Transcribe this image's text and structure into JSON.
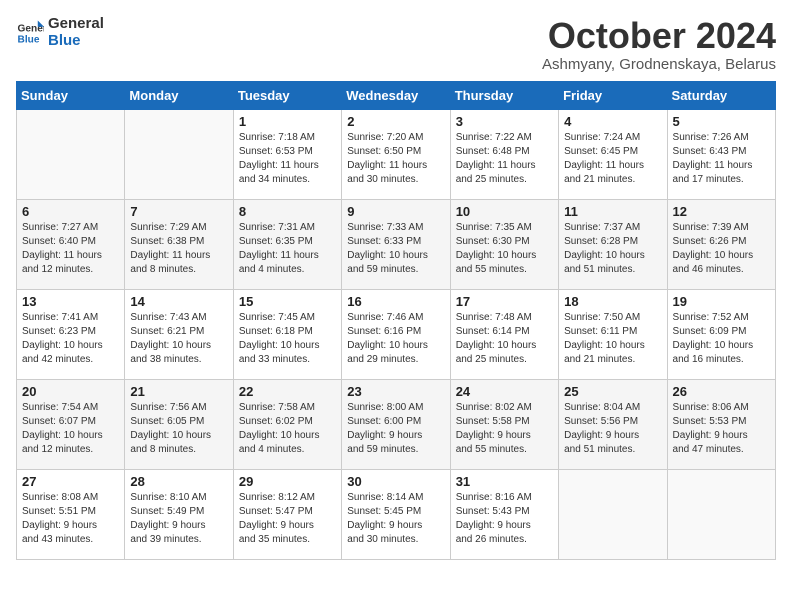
{
  "logo": {
    "line1": "General",
    "line2": "Blue"
  },
  "title": "October 2024",
  "subtitle": "Ashmyany, Grodnenskaya, Belarus",
  "weekdays": [
    "Sunday",
    "Monday",
    "Tuesday",
    "Wednesday",
    "Thursday",
    "Friday",
    "Saturday"
  ],
  "weeks": [
    [
      {
        "day": "",
        "info": ""
      },
      {
        "day": "",
        "info": ""
      },
      {
        "day": "1",
        "info": "Sunrise: 7:18 AM\nSunset: 6:53 PM\nDaylight: 11 hours\nand 34 minutes."
      },
      {
        "day": "2",
        "info": "Sunrise: 7:20 AM\nSunset: 6:50 PM\nDaylight: 11 hours\nand 30 minutes."
      },
      {
        "day": "3",
        "info": "Sunrise: 7:22 AM\nSunset: 6:48 PM\nDaylight: 11 hours\nand 25 minutes."
      },
      {
        "day": "4",
        "info": "Sunrise: 7:24 AM\nSunset: 6:45 PM\nDaylight: 11 hours\nand 21 minutes."
      },
      {
        "day": "5",
        "info": "Sunrise: 7:26 AM\nSunset: 6:43 PM\nDaylight: 11 hours\nand 17 minutes."
      }
    ],
    [
      {
        "day": "6",
        "info": "Sunrise: 7:27 AM\nSunset: 6:40 PM\nDaylight: 11 hours\nand 12 minutes."
      },
      {
        "day": "7",
        "info": "Sunrise: 7:29 AM\nSunset: 6:38 PM\nDaylight: 11 hours\nand 8 minutes."
      },
      {
        "day": "8",
        "info": "Sunrise: 7:31 AM\nSunset: 6:35 PM\nDaylight: 11 hours\nand 4 minutes."
      },
      {
        "day": "9",
        "info": "Sunrise: 7:33 AM\nSunset: 6:33 PM\nDaylight: 10 hours\nand 59 minutes."
      },
      {
        "day": "10",
        "info": "Sunrise: 7:35 AM\nSunset: 6:30 PM\nDaylight: 10 hours\nand 55 minutes."
      },
      {
        "day": "11",
        "info": "Sunrise: 7:37 AM\nSunset: 6:28 PM\nDaylight: 10 hours\nand 51 minutes."
      },
      {
        "day": "12",
        "info": "Sunrise: 7:39 AM\nSunset: 6:26 PM\nDaylight: 10 hours\nand 46 minutes."
      }
    ],
    [
      {
        "day": "13",
        "info": "Sunrise: 7:41 AM\nSunset: 6:23 PM\nDaylight: 10 hours\nand 42 minutes."
      },
      {
        "day": "14",
        "info": "Sunrise: 7:43 AM\nSunset: 6:21 PM\nDaylight: 10 hours\nand 38 minutes."
      },
      {
        "day": "15",
        "info": "Sunrise: 7:45 AM\nSunset: 6:18 PM\nDaylight: 10 hours\nand 33 minutes."
      },
      {
        "day": "16",
        "info": "Sunrise: 7:46 AM\nSunset: 6:16 PM\nDaylight: 10 hours\nand 29 minutes."
      },
      {
        "day": "17",
        "info": "Sunrise: 7:48 AM\nSunset: 6:14 PM\nDaylight: 10 hours\nand 25 minutes."
      },
      {
        "day": "18",
        "info": "Sunrise: 7:50 AM\nSunset: 6:11 PM\nDaylight: 10 hours\nand 21 minutes."
      },
      {
        "day": "19",
        "info": "Sunrise: 7:52 AM\nSunset: 6:09 PM\nDaylight: 10 hours\nand 16 minutes."
      }
    ],
    [
      {
        "day": "20",
        "info": "Sunrise: 7:54 AM\nSunset: 6:07 PM\nDaylight: 10 hours\nand 12 minutes."
      },
      {
        "day": "21",
        "info": "Sunrise: 7:56 AM\nSunset: 6:05 PM\nDaylight: 10 hours\nand 8 minutes."
      },
      {
        "day": "22",
        "info": "Sunrise: 7:58 AM\nSunset: 6:02 PM\nDaylight: 10 hours\nand 4 minutes."
      },
      {
        "day": "23",
        "info": "Sunrise: 8:00 AM\nSunset: 6:00 PM\nDaylight: 9 hours\nand 59 minutes."
      },
      {
        "day": "24",
        "info": "Sunrise: 8:02 AM\nSunset: 5:58 PM\nDaylight: 9 hours\nand 55 minutes."
      },
      {
        "day": "25",
        "info": "Sunrise: 8:04 AM\nSunset: 5:56 PM\nDaylight: 9 hours\nand 51 minutes."
      },
      {
        "day": "26",
        "info": "Sunrise: 8:06 AM\nSunset: 5:53 PM\nDaylight: 9 hours\nand 47 minutes."
      }
    ],
    [
      {
        "day": "27",
        "info": "Sunrise: 8:08 AM\nSunset: 5:51 PM\nDaylight: 9 hours\nand 43 minutes."
      },
      {
        "day": "28",
        "info": "Sunrise: 8:10 AM\nSunset: 5:49 PM\nDaylight: 9 hours\nand 39 minutes."
      },
      {
        "day": "29",
        "info": "Sunrise: 8:12 AM\nSunset: 5:47 PM\nDaylight: 9 hours\nand 35 minutes."
      },
      {
        "day": "30",
        "info": "Sunrise: 8:14 AM\nSunset: 5:45 PM\nDaylight: 9 hours\nand 30 minutes."
      },
      {
        "day": "31",
        "info": "Sunrise: 8:16 AM\nSunset: 5:43 PM\nDaylight: 9 hours\nand 26 minutes."
      },
      {
        "day": "",
        "info": ""
      },
      {
        "day": "",
        "info": ""
      }
    ]
  ]
}
